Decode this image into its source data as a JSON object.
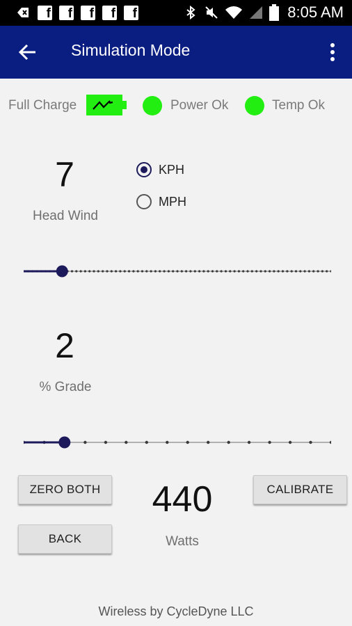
{
  "status_bar": {
    "time": "8:05 AM",
    "icons": [
      "notification-icon",
      "facebook-icon",
      "facebook-icon",
      "facebook-icon",
      "facebook-icon",
      "facebook-icon",
      "bluetooth-icon",
      "mute-icon",
      "wifi-icon",
      "signal-icon",
      "battery-icon"
    ],
    "fb_letter": "f"
  },
  "app_bar": {
    "title": "Simulation Mode",
    "color": "#0a1e82"
  },
  "device_status": {
    "charge_label": "Full Charge",
    "power_label": "Power Ok",
    "temp_label": "Temp Ok",
    "ok_color": "#22ee11"
  },
  "head_wind": {
    "value": "7",
    "label": "Head Wind",
    "slider_fraction": 0.125
  },
  "units": {
    "options": [
      "KPH",
      "MPH"
    ],
    "selected": "KPH"
  },
  "grade": {
    "value": "2",
    "label": "% Grade",
    "slider_fraction": 0.133
  },
  "buttons": {
    "zero_both": "ZERO BOTH",
    "calibrate": "CALIBRATE",
    "back": "BACK"
  },
  "power": {
    "value": "440",
    "label": "Watts"
  },
  "footer": {
    "text": "Wireless by CycleDyne LLC"
  }
}
